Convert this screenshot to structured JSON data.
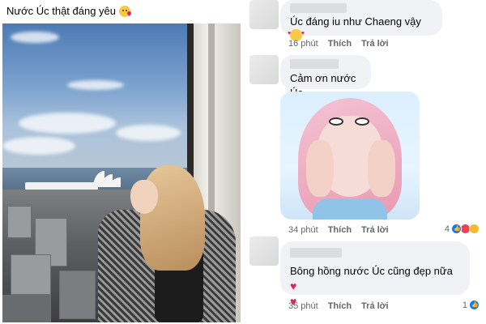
{
  "post": {
    "caption": "Nước Úc thật đáng yêu",
    "caption_emoji": "kissing-face-icon"
  },
  "comments": [
    {
      "text": "Úc đáng iu như Chaeng vậy",
      "emoji": "smiling-face-with-hearts-icon",
      "time": "16 phút",
      "like": "Thích",
      "reply": "Trả lời"
    },
    {
      "text": "Cảm ơn nước Úc",
      "attachment": "gif-image",
      "time": "34 phút",
      "like": "Thích",
      "reply": "Trả lời",
      "reaction_count": "4",
      "reactions": [
        "like-icon",
        "love-icon",
        "haha-icon"
      ]
    },
    {
      "text": "Bông hồng nước Úc cũng đẹp nữa",
      "emoji": "red-heart-icon",
      "time": "35 phút",
      "like": "Thích",
      "reply": "Trả lời",
      "reaction_count": "1",
      "reactions": [
        "like-icon"
      ]
    }
  ],
  "colors": {
    "bubble": "#f0f2f5",
    "meta_text": "#65676b",
    "like_blue": "#1877f2",
    "love_red": "#f33e58"
  }
}
